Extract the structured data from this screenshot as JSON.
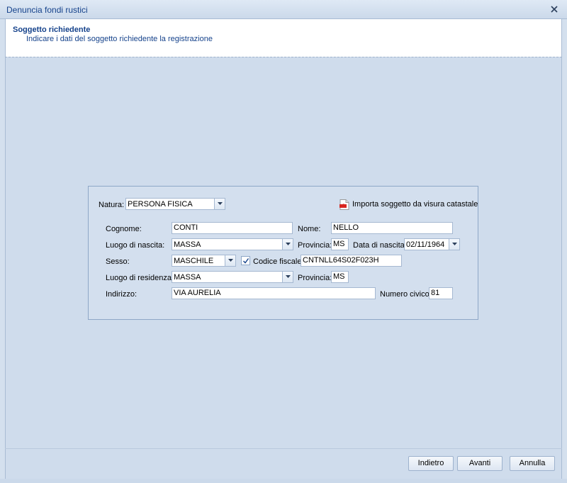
{
  "window": {
    "title": "Denuncia fondi rustici"
  },
  "header": {
    "title": "Soggetto richiedente",
    "subtitle": "Indicare i dati del soggetto richiedente la registrazione"
  },
  "form": {
    "natura_label": "Natura:",
    "natura_value": "PERSONA FISICA",
    "import_label": "Importa soggetto da visura catastale",
    "cognome_label": "Cognome:",
    "cognome_value": "CONTI",
    "nome_label": "Nome:",
    "nome_value": "NELLO",
    "luogo_nascita_label": "Luogo di nascita:",
    "luogo_nascita_value": "MASSA",
    "provincia_label": "Provincia:",
    "provincia_nascita_value": "MS",
    "data_nascita_label": "Data di nascita:",
    "data_nascita_value": "02/11/1964",
    "sesso_label": "Sesso:",
    "sesso_value": "MASCHILE",
    "codice_fiscale_label": "Codice fiscale:",
    "codice_fiscale_value": "CNTNLL64S02F023H",
    "codice_fiscale_checked": true,
    "luogo_residenza_label": "Luogo di residenza:",
    "luogo_residenza_value": "MASSA",
    "provincia_residenza_value": "MS",
    "indirizzo_label": "Indirizzo:",
    "indirizzo_value": "VIA AURELIA",
    "numero_civico_label": "Numero civico:",
    "numero_civico_value": "81"
  },
  "footer": {
    "back_label": "Indietro",
    "next_label": "Avanti",
    "cancel_label": "Annulla"
  },
  "icons": {
    "close": "close-icon",
    "dropdown": "chevron-down-icon",
    "pdf": "pdf-icon",
    "check": "checkmark-icon"
  },
  "colors": {
    "background": "#cfdcec",
    "title_text": "#15428b",
    "panel_border": "#8ea7c7"
  }
}
